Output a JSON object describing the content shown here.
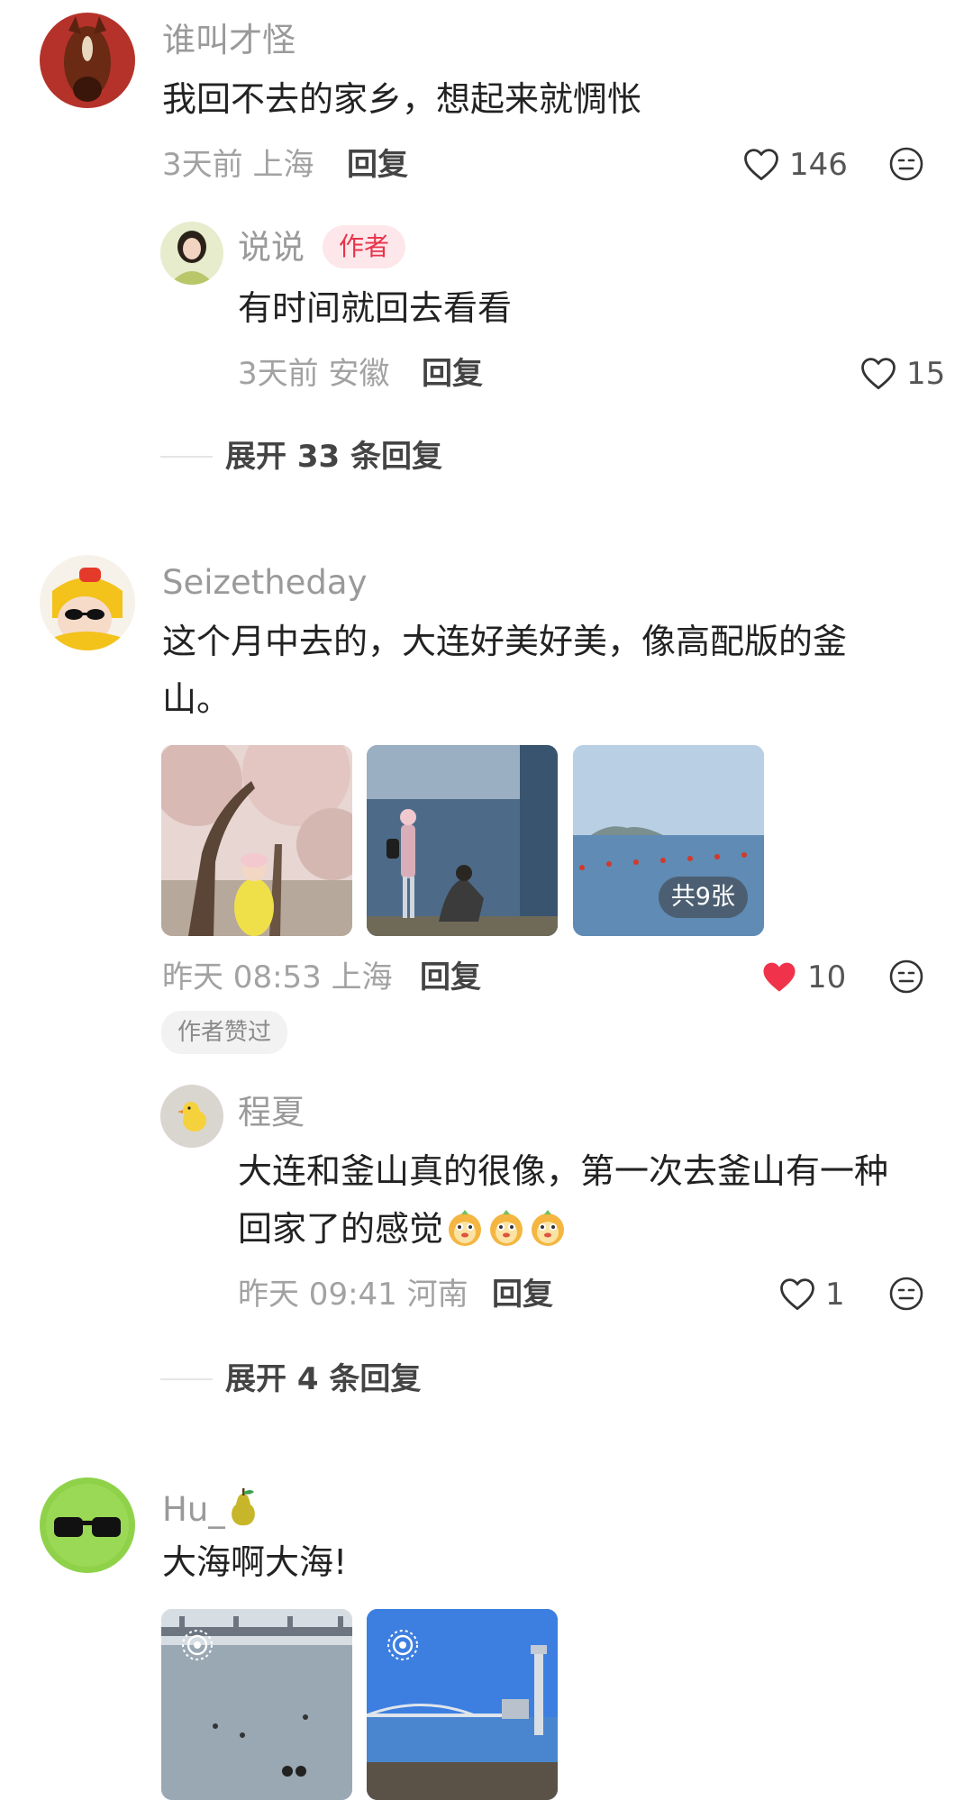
{
  "comments": [
    {
      "user": "谁叫才怪",
      "text": "我回不去的家乡，想起来就惆怅",
      "meta": "3天前 上海",
      "reply_label": "回复",
      "likes": "146",
      "liked": false,
      "replies": [
        {
          "user": "说说",
          "badge": "作者",
          "text": "有时间就回去看看",
          "meta": "3天前 安徽",
          "reply_label": "回复",
          "likes": "15"
        }
      ],
      "expand_label": "展开 33 条回复"
    },
    {
      "user": "Seizetheday",
      "text_line1": "这个月中去的，大连好美好美，像高配版的釜",
      "text_line2": "山。",
      "images_count_label": "共9张",
      "meta": "昨天 08:53 上海",
      "reply_label": "回复",
      "likes": "10",
      "liked": true,
      "author_liked_label": "作者赞过",
      "replies": [
        {
          "user": "程夏",
          "text_line1": "大连和釜山真的很像，第一次去釜山有一种",
          "text_line2": "回家了的感觉",
          "meta": "昨天 09:41 河南",
          "reply_label": "回复",
          "likes": "1"
        }
      ],
      "expand_label": "展开 4 条回复"
    },
    {
      "user": "Hu_",
      "text": "大海啊大海!"
    }
  ],
  "icons": {
    "like": "heart-outline-icon",
    "liked": "heart-filled-icon",
    "emoji": "smiley-icon",
    "live_photo": "live-photo-icon"
  },
  "colors": {
    "author_badge": "#e8334a",
    "liked_heart": "#f0334a"
  }
}
